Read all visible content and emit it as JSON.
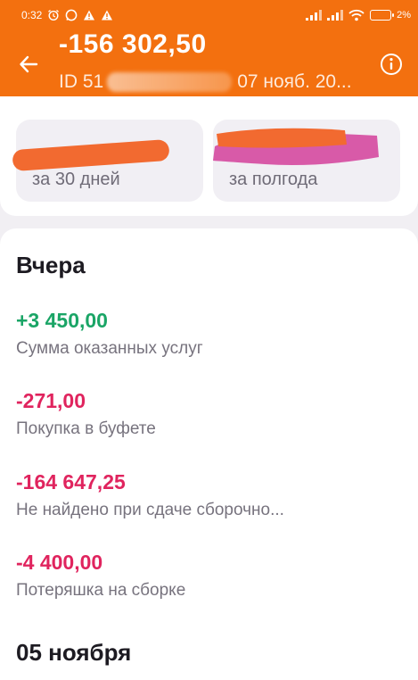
{
  "status_bar": {
    "time": "0:32",
    "battery": "2%"
  },
  "header": {
    "title": "-156 302,50",
    "id_label": "ID 51",
    "date_text": "07 нояб. 20..."
  },
  "summary_tiles": [
    {
      "caption": "за 30 дней"
    },
    {
      "caption": "за полгода"
    }
  ],
  "groups": [
    {
      "title": "Вчера",
      "transactions": [
        {
          "amount": "+3 450,00",
          "description": "Сумма оказанных услуг",
          "type": "income"
        },
        {
          "amount": "-271,00",
          "description": "Покупка в буфете",
          "type": "expense"
        },
        {
          "amount": "-164 647,25",
          "description": "Не найдено при сдаче сборочно...",
          "type": "expense"
        },
        {
          "amount": "-4 400,00",
          "description": "Потеряшка на сборке",
          "type": "expense"
        }
      ]
    },
    {
      "title": "05 ноября",
      "transactions": []
    }
  ],
  "colors": {
    "header_bg": "#f3700f",
    "income": "#1aa566",
    "expense": "#e0245e",
    "background": "#f1eff3"
  },
  "icons": {
    "back": "arrow-left-icon",
    "info": "info-icon"
  }
}
